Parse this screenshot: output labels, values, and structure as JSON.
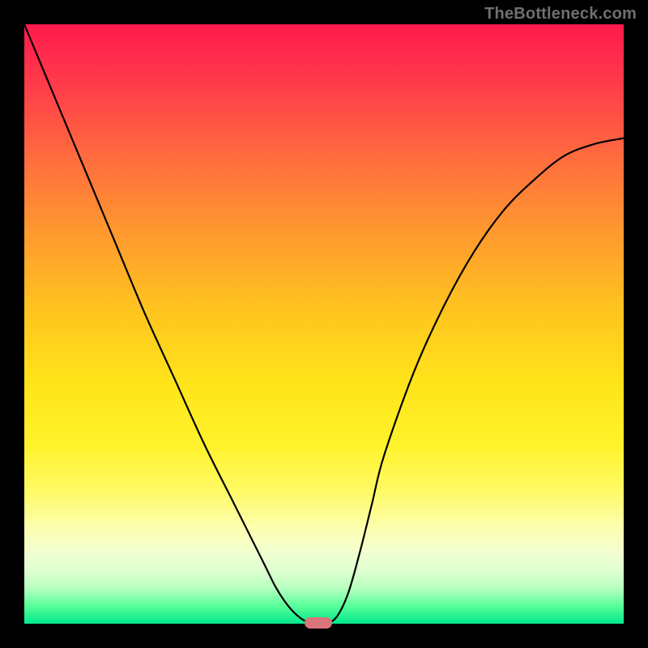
{
  "watermark": "TheBottleneck.com",
  "colors": {
    "top": "#ff1a4d",
    "bottom": "#00e88c",
    "curve": "#000000",
    "marker": "#d9757a",
    "frame": "#000000"
  },
  "chart_data": {
    "type": "line",
    "title": "",
    "xlabel": "",
    "ylabel": "",
    "xlim": [
      0,
      100
    ],
    "ylim": [
      0,
      100
    ],
    "grid": false,
    "legend": false,
    "x": [
      0,
      5,
      10,
      15,
      20,
      25,
      30,
      35,
      40,
      42,
      44,
      46,
      48,
      50,
      52,
      54,
      56,
      58,
      60,
      65,
      70,
      75,
      80,
      85,
      90,
      95,
      100
    ],
    "values": [
      100,
      88,
      76,
      64,
      52,
      41,
      30,
      20,
      10,
      6,
      3,
      1,
      0,
      0,
      1,
      5,
      12,
      20,
      28,
      42,
      53,
      62,
      69,
      74,
      78,
      80,
      81
    ],
    "minimum_at_x": 49,
    "annotations": [
      {
        "type": "marker",
        "x": 49,
        "y": 0,
        "shape": "rounded-rect",
        "color": "#d9757a"
      }
    ]
  }
}
